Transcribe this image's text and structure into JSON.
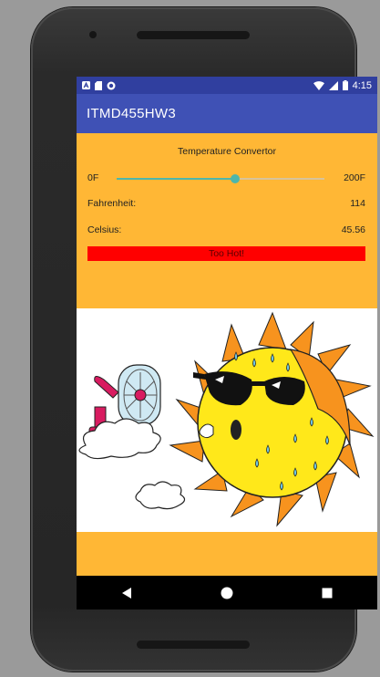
{
  "status_bar": {
    "left_icons": [
      "a-notification-icon",
      "sd-card-icon",
      "sync-icon"
    ],
    "right_icons": [
      "wifi-icon",
      "signal-icon",
      "battery-icon"
    ],
    "time": "4:15"
  },
  "app_bar": {
    "title": "ITMD455HW3"
  },
  "converter": {
    "title": "Temperature Convertor",
    "slider": {
      "min_label": "0F",
      "max_label": "200F",
      "min": 0,
      "max": 200,
      "value": 114
    },
    "fahrenheit_label": "Fahrenheit:",
    "fahrenheit_value": "114",
    "celsius_label": "Celsius:",
    "celsius_value": "45.56",
    "status_message": "Too Hot!"
  },
  "illustration": {
    "subject": "hot-sun-with-sunglasses-and-fan-icon"
  },
  "nav_bar": {
    "icons": [
      "back-icon",
      "home-icon",
      "recents-icon"
    ]
  },
  "colors": {
    "background": "#FFB735",
    "app_bar": "#3F51B5",
    "status_bar": "#303F9F",
    "slider_accent": "#4DB6AC",
    "status_banner": "#FF0000"
  }
}
